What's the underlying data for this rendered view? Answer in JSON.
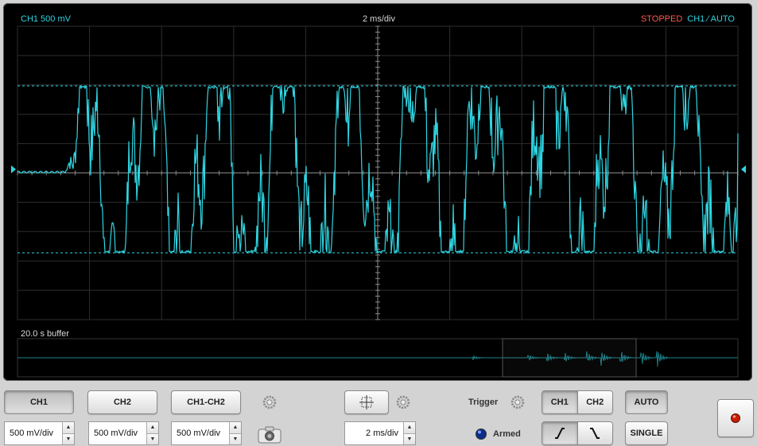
{
  "scope": {
    "channel_label": "CH1 500 mV",
    "timebase_label": "2 ms/div",
    "status": "STOPPED",
    "trigger_status": "CH1 ∕ AUTO",
    "buffer_label": "20.0 s buffer"
  },
  "controls": {
    "ch1": "CH1",
    "ch2": "CH2",
    "ch1_minus_ch2": "CH1-CH2",
    "ch1_scale": "500 mV/div",
    "ch2_scale": "500 mV/div",
    "math_scale": "500 mV/div",
    "timebase": "2 ms/div",
    "trigger_label": "Trigger",
    "armed_label": "Armed",
    "trig_ch1": "CH1",
    "trig_ch2": "CH2",
    "mode_auto": "AUTO",
    "mode_single": "SINGLE"
  },
  "colors": {
    "trace": "#2fd6e3",
    "grid": "#2e2e2e",
    "status": "#ff5a4e",
    "record": "#c81e00"
  }
}
